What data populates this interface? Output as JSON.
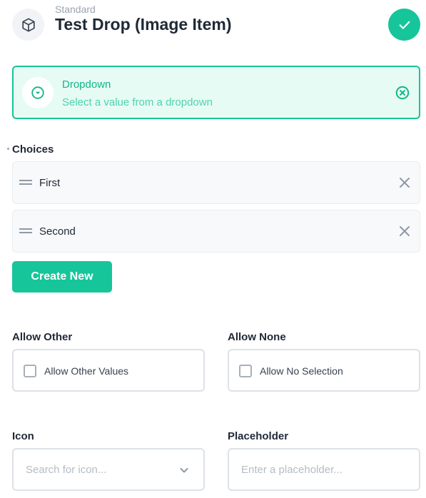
{
  "header": {
    "subtitle": "Standard",
    "title": "Test Drop (Image Item)",
    "type_icon": "cube-icon",
    "save_icon": "check-icon"
  },
  "interface": {
    "name": "Dropdown",
    "description": "Select a value from a dropdown",
    "icon": "arrow-drop-down-circle-icon",
    "deselect_icon": "close-circle-icon"
  },
  "choices": {
    "label": "Choices",
    "items": [
      {
        "label": "First"
      },
      {
        "label": "Second"
      }
    ],
    "create_label": "Create New"
  },
  "allow_other": {
    "label": "Allow Other",
    "checkbox_label": "Allow Other Values",
    "checked": false
  },
  "allow_none": {
    "label": "Allow None",
    "checkbox_label": "Allow No Selection",
    "checked": false
  },
  "icon_field": {
    "label": "Icon",
    "placeholder": "Search for icon..."
  },
  "placeholder_field": {
    "label": "Placeholder",
    "placeholder": "Enter a placeholder..."
  },
  "colors": {
    "accent": "#16c59a",
    "accent_light": "#e6fbf4",
    "text": "#1f2937",
    "muted": "#9aa3af"
  }
}
